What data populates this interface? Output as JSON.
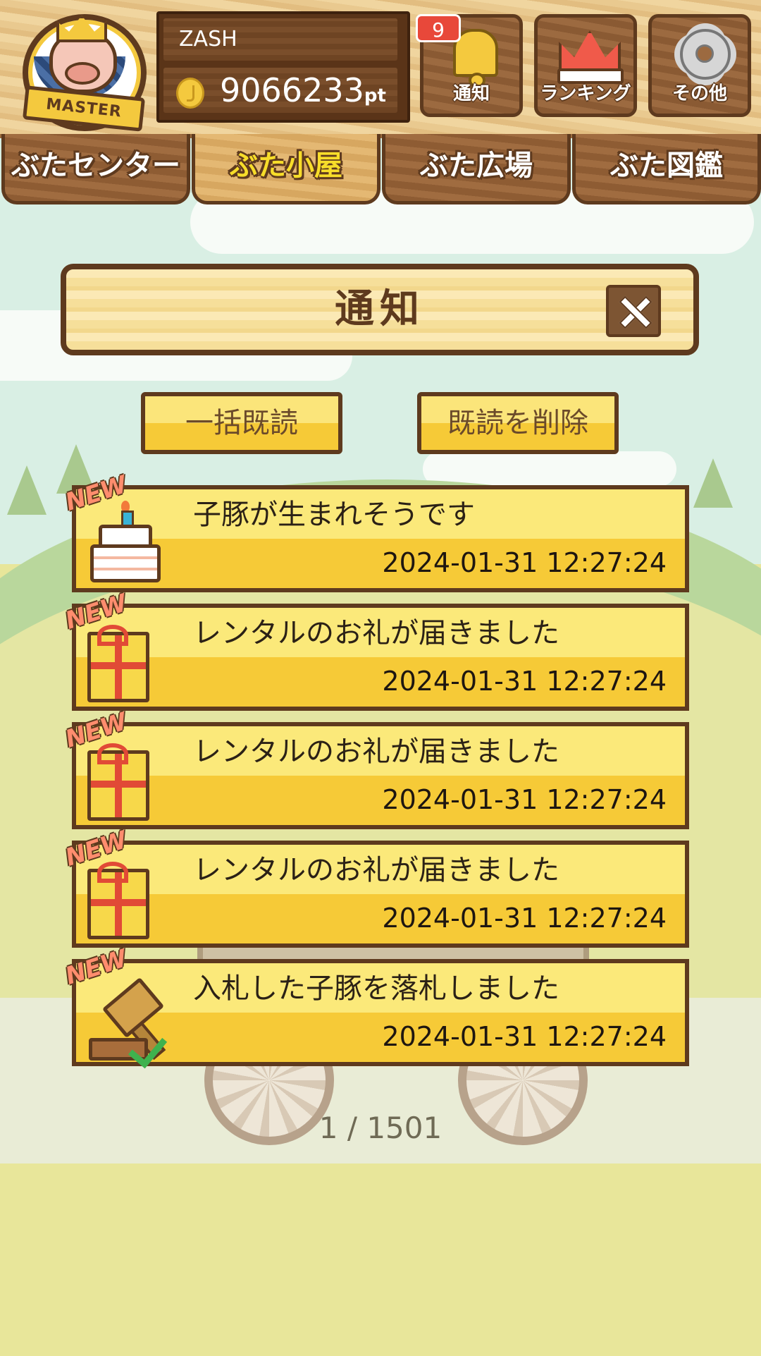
{
  "header": {
    "rank_badge": "MASTER",
    "username": "ZASH",
    "points_value": "9066233",
    "points_unit": "pt",
    "notification_count": "9",
    "buttons": {
      "notify_label": "通知",
      "ranking_label": "ランキング",
      "other_label": "その他"
    }
  },
  "tabs": [
    {
      "label": "ぶたセンター"
    },
    {
      "label": "ぶた小屋"
    },
    {
      "label": "ぶた広場"
    },
    {
      "label": "ぶた図鑑"
    }
  ],
  "active_tab": "ぶた小屋",
  "dialog": {
    "title": "通知",
    "mark_all_read": "一括既読",
    "delete_read": "既読を削除"
  },
  "notifications": [
    {
      "tag": "NEW",
      "icon": "cake-icon",
      "message": "子豚が生まれそうです",
      "timestamp": "2024-01-31 12:27:24"
    },
    {
      "tag": "NEW",
      "icon": "gift-icon",
      "message": "レンタルのお礼が届きました",
      "timestamp": "2024-01-31 12:27:24"
    },
    {
      "tag": "NEW",
      "icon": "gift-icon",
      "message": "レンタルのお礼が届きました",
      "timestamp": "2024-01-31 12:27:24"
    },
    {
      "tag": "NEW",
      "icon": "gift-icon",
      "message": "レンタルのお礼が届きました",
      "timestamp": "2024-01-31 12:27:24"
    },
    {
      "tag": "NEW",
      "icon": "gavel-icon",
      "message": "入札した子豚を落札しました",
      "timestamp": "2024-01-31 12:27:24"
    }
  ],
  "pager": "1 / 1501",
  "colors": {
    "wood_dark": "#5e3a1e",
    "item_yellow": "#f6ca37",
    "tab_active_text": "#f7dd2a",
    "badge_red": "#e8483a"
  }
}
